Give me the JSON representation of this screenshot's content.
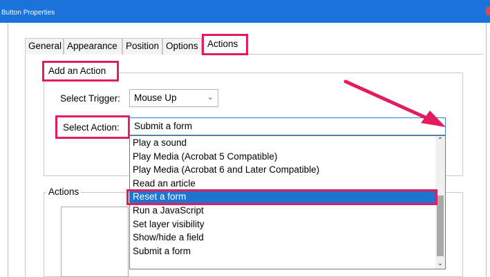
{
  "window": {
    "title": "Button Properties"
  },
  "tabs": [
    {
      "label": "General"
    },
    {
      "label": "Appearance"
    },
    {
      "label": "Position"
    },
    {
      "label": "Options"
    },
    {
      "label": "Actions",
      "active": true
    }
  ],
  "add_action": {
    "legend": "Add an Action",
    "trigger_label": "Select Trigger:",
    "trigger_value": "Mouse Up",
    "action_label": "Select Action:",
    "action_value": "Submit a form"
  },
  "dropdown": {
    "items": [
      "Play a sound",
      "Play Media (Acrobat 5 Compatible)",
      "Play Media (Acrobat 6 and Later Compatible)",
      "Read an article",
      "Reset a form",
      "Run a JavaScript",
      "Set layer visibility",
      "Show/hide a field",
      "Submit a form"
    ],
    "selected": "Reset a form"
  },
  "actions_group": {
    "legend": "Actions"
  },
  "colors": {
    "highlight": "#e31c5f",
    "selection": "#1f74d0",
    "titlebar": "#1a73d8"
  },
  "icons": {
    "trigger_chevron": "chevron-down-icon",
    "scroll_up": "chevron-up-icon",
    "scroll_down": "chevron-down-icon",
    "annotation_arrow": "arrow-icon"
  }
}
